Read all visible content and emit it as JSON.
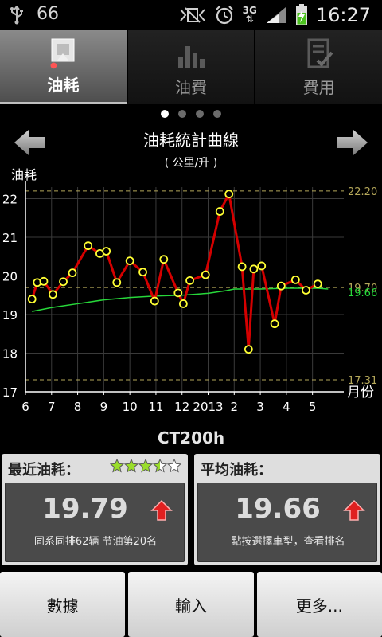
{
  "status_bar": {
    "battery_level_text": "66",
    "network": "3G",
    "clock": "16:27"
  },
  "tabs": [
    {
      "label": "油耗",
      "icon": "fuel-consumption-icon",
      "active": true
    },
    {
      "label": "油費",
      "icon": "bar-chart-icon",
      "active": false
    },
    {
      "label": "費用",
      "icon": "checklist-icon",
      "active": false
    }
  ],
  "pager": {
    "count": 4,
    "active_index": 0
  },
  "chart_header": {
    "title": "油耗統計曲線",
    "unit": "( 公里/升 )"
  },
  "chart_data": {
    "type": "line",
    "ylabel": "油耗",
    "xlabel": "月份",
    "ylim": [
      17,
      22.3
    ],
    "yticks": [
      17,
      18,
      19,
      20,
      21,
      22
    ],
    "xticks": [
      {
        "label": "6",
        "x": 0
      },
      {
        "label": "7",
        "x": 1
      },
      {
        "label": "8",
        "x": 2
      },
      {
        "label": "9",
        "x": 3
      },
      {
        "label": "10",
        "x": 4
      },
      {
        "label": "11",
        "x": 5
      },
      {
        "label": "12",
        "x": 6
      },
      {
        "label": "2013",
        "x": 7
      },
      {
        "label": "2",
        "x": 8
      },
      {
        "label": "3",
        "x": 9
      },
      {
        "label": "4",
        "x": 10
      },
      {
        "label": "5",
        "x": 11
      }
    ],
    "xlim": [
      0,
      12.2
    ],
    "reference_lines": [
      {
        "value": 22.2,
        "label": "22.20"
      },
      {
        "value": 19.7,
        "label": "19.70"
      },
      {
        "value": 17.31,
        "label": "17.31"
      }
    ],
    "series": [
      {
        "role": "fuel consumption",
        "color": "#d40000",
        "marker_color": "#ffff33",
        "points": [
          [
            0.25,
            19.4
          ],
          [
            0.45,
            19.83
          ],
          [
            0.7,
            19.86
          ],
          [
            1.05,
            19.52
          ],
          [
            1.45,
            19.85
          ],
          [
            1.8,
            20.08
          ],
          [
            2.4,
            20.78
          ],
          [
            2.85,
            20.58
          ],
          [
            3.1,
            20.64
          ],
          [
            3.5,
            19.83
          ],
          [
            4.0,
            20.39
          ],
          [
            4.5,
            20.1
          ],
          [
            4.95,
            19.35
          ],
          [
            5.3,
            20.43
          ],
          [
            5.85,
            19.56
          ],
          [
            6.05,
            19.28
          ],
          [
            6.3,
            19.88
          ],
          [
            6.9,
            20.03
          ],
          [
            7.45,
            21.67
          ],
          [
            7.8,
            22.12
          ],
          [
            8.3,
            20.24
          ],
          [
            8.55,
            18.1
          ],
          [
            8.75,
            20.18
          ],
          [
            9.05,
            20.26
          ],
          [
            9.55,
            18.76
          ],
          [
            9.8,
            19.74
          ],
          [
            10.35,
            19.9
          ],
          [
            10.75,
            19.63
          ],
          [
            11.2,
            19.79
          ]
        ]
      },
      {
        "role": "average",
        "color": "#27d83a",
        "end_label": "19.66",
        "points": [
          [
            0.25,
            19.08
          ],
          [
            1.0,
            19.18
          ],
          [
            2.0,
            19.28
          ],
          [
            3.0,
            19.38
          ],
          [
            4.0,
            19.44
          ],
          [
            5.0,
            19.48
          ],
          [
            6.0,
            19.5
          ],
          [
            7.0,
            19.55
          ],
          [
            7.7,
            19.62
          ],
          [
            8.0,
            19.66
          ],
          [
            9.0,
            19.66
          ],
          [
            10.0,
            19.68
          ],
          [
            11.2,
            19.68
          ],
          [
            11.6,
            19.66
          ]
        ]
      }
    ],
    "grid": true
  },
  "vehicle": {
    "model": "CT200h"
  },
  "recent": {
    "title": "最近油耗：",
    "value": "19.79",
    "rating": 3.5,
    "rating_max": 5,
    "note": "同系同排62辆  节油第20名"
  },
  "average": {
    "title": "平均油耗：",
    "value": "19.66",
    "note": "點按選擇車型，查看排名"
  },
  "bottom_buttons": {
    "data": "數據",
    "input": "輸入",
    "more": "更多..."
  },
  "colors": {
    "reference_line": "#b5a85a",
    "average_label": "#27d83a",
    "up_arrow": "#e02020"
  }
}
